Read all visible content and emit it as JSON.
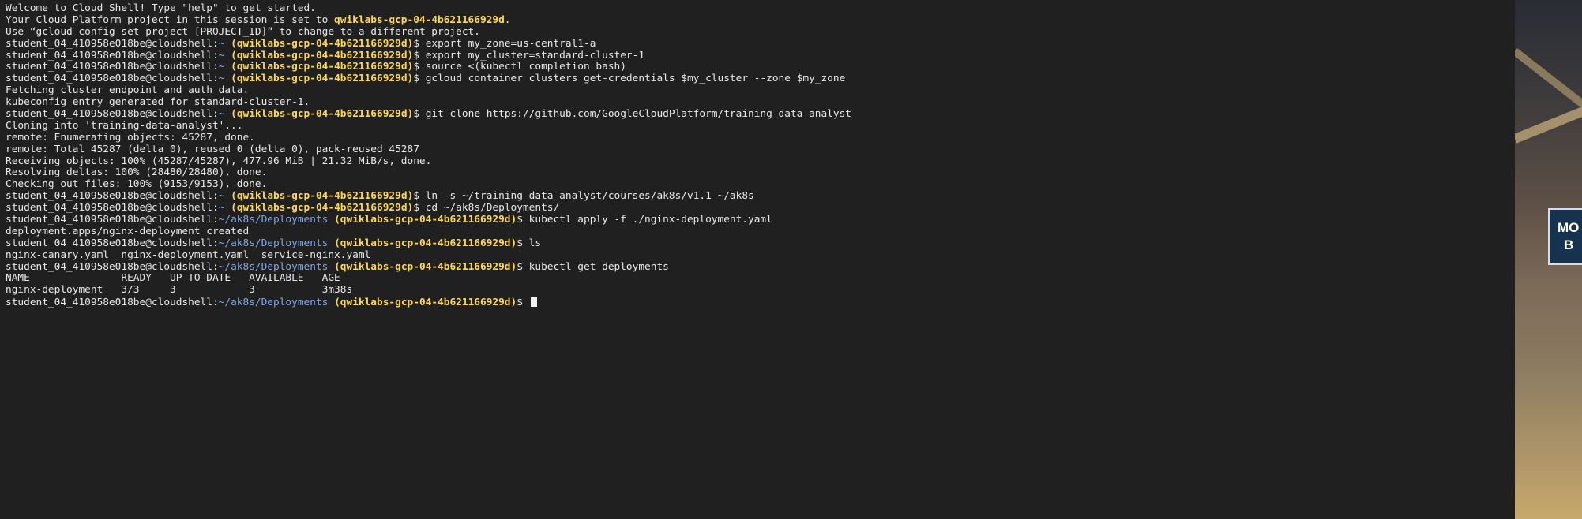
{
  "terminal": {
    "lines": [
      {
        "type": "out",
        "text": "Welcome to Cloud Shell! Type \"help\" to get started."
      },
      {
        "type": "out_hl",
        "text": "Your Cloud Platform project in this session is set to ",
        "hl": "qwiklabs-gcp-04-4b621166929d",
        "suffix": "."
      },
      {
        "type": "out",
        "text": "Use “gcloud config set project [PROJECT_ID]” to change to a different project."
      },
      {
        "type": "prompt",
        "user": "student_04_410958e018be@cloudshell",
        "path": "~",
        "project": "(qwiklabs-gcp-04-4b621166929d)",
        "cmd": "export my_zone=us-central1-a"
      },
      {
        "type": "prompt",
        "user": "student_04_410958e018be@cloudshell",
        "path": "~",
        "project": "(qwiklabs-gcp-04-4b621166929d)",
        "cmd": "export my_cluster=standard-cluster-1"
      },
      {
        "type": "prompt",
        "user": "student_04_410958e018be@cloudshell",
        "path": "~",
        "project": "(qwiklabs-gcp-04-4b621166929d)",
        "cmd": "source <(kubectl completion bash)"
      },
      {
        "type": "prompt",
        "user": "student_04_410958e018be@cloudshell",
        "path": "~",
        "project": "(qwiklabs-gcp-04-4b621166929d)",
        "cmd": "gcloud container clusters get-credentials $my_cluster --zone $my_zone"
      },
      {
        "type": "out",
        "text": "Fetching cluster endpoint and auth data."
      },
      {
        "type": "out",
        "text": "kubeconfig entry generated for standard-cluster-1."
      },
      {
        "type": "prompt",
        "user": "student_04_410958e018be@cloudshell",
        "path": "~",
        "project": "(qwiklabs-gcp-04-4b621166929d)",
        "cmd": "git clone https://github.com/GoogleCloudPlatform/training-data-analyst"
      },
      {
        "type": "out",
        "text": "Cloning into 'training-data-analyst'..."
      },
      {
        "type": "out",
        "text": "remote: Enumerating objects: 45287, done."
      },
      {
        "type": "out",
        "text": "remote: Total 45287 (delta 0), reused 0 (delta 0), pack-reused 45287"
      },
      {
        "type": "out",
        "text": "Receiving objects: 100% (45287/45287), 477.96 MiB | 21.32 MiB/s, done."
      },
      {
        "type": "out",
        "text": "Resolving deltas: 100% (28480/28480), done."
      },
      {
        "type": "out",
        "text": "Checking out files: 100% (9153/9153), done."
      },
      {
        "type": "prompt",
        "user": "student_04_410958e018be@cloudshell",
        "path": "~",
        "project": "(qwiklabs-gcp-04-4b621166929d)",
        "cmd": "ln -s ~/training-data-analyst/courses/ak8s/v1.1 ~/ak8s"
      },
      {
        "type": "prompt",
        "user": "student_04_410958e018be@cloudshell",
        "path": "~",
        "project": "(qwiklabs-gcp-04-4b621166929d)",
        "cmd": "cd ~/ak8s/Deployments/"
      },
      {
        "type": "prompt",
        "user": "student_04_410958e018be@cloudshell",
        "path": "~/ak8s/Deployments",
        "project": "(qwiklabs-gcp-04-4b621166929d)",
        "cmd": "kubectl apply -f ./nginx-deployment.yaml"
      },
      {
        "type": "out",
        "text": "deployment.apps/nginx-deployment created"
      },
      {
        "type": "prompt",
        "user": "student_04_410958e018be@cloudshell",
        "path": "~/ak8s/Deployments",
        "project": "(qwiklabs-gcp-04-4b621166929d)",
        "cmd": "ls"
      },
      {
        "type": "out",
        "text": "nginx-canary.yaml  nginx-deployment.yaml  service-nginx.yaml"
      },
      {
        "type": "prompt",
        "user": "student_04_410958e018be@cloudshell",
        "path": "~/ak8s/Deployments",
        "project": "(qwiklabs-gcp-04-4b621166929d)",
        "cmd": "kubectl get deployments"
      },
      {
        "type": "out",
        "text": "NAME               READY   UP-TO-DATE   AVAILABLE   AGE"
      },
      {
        "type": "out",
        "text": "nginx-deployment   3/3     3            3           3m38s"
      },
      {
        "type": "prompt",
        "user": "student_04_410958e018be@cloudshell",
        "path": "~/ak8s/Deployments",
        "project": "(qwiklabs-gcp-04-4b621166929d)",
        "cmd": "",
        "cursor": true
      }
    ],
    "prompt_symbol": "$",
    "colors": {
      "background": "#202020",
      "text": "#e8e8e8",
      "project": "#ffd94a",
      "path": "#7fa7ea"
    }
  },
  "side_panel": {
    "sign_text_1": "MO",
    "sign_text_2": "B"
  }
}
